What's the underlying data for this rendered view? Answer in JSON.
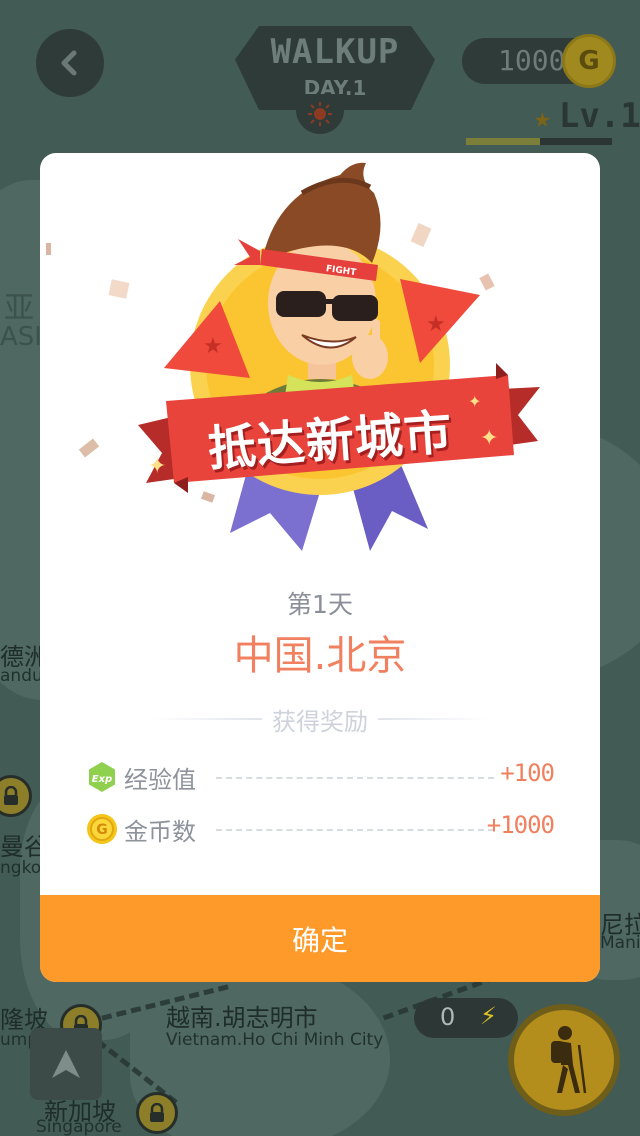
{
  "header": {
    "app_title": "WALKUP",
    "day": "DAY.1",
    "coins": "1000",
    "coin_symbol": "G",
    "level": "Lv.1",
    "level_progress": 0.51
  },
  "map": {
    "labels": [
      {
        "text": "德洲",
        "sub": false
      },
      {
        "text": "andu",
        "sub": true
      },
      {
        "text": "曼谷",
        "sub": false
      },
      {
        "text": "ngkok",
        "sub": true
      },
      {
        "text": "隆坡",
        "sub": false
      },
      {
        "text": "umpur",
        "sub": true
      },
      {
        "text": "越南.胡志明市",
        "sub": false
      },
      {
        "text": "Vietnam.Ho Chi Minh City",
        "sub": true
      },
      {
        "text": "新加坡",
        "sub": false
      },
      {
        "text": "Singapore",
        "sub": true
      },
      {
        "text": "尼拉",
        "sub": false
      },
      {
        "text": "Mani",
        "sub": true
      },
      {
        "text": "亚",
        "sub": false
      },
      {
        "text": "ASI",
        "sub": true
      }
    ],
    "energy": "0"
  },
  "dialog": {
    "banner": "抵达新城市",
    "headband": "FIGHT",
    "day_label": "第1天",
    "city": "中国.北京",
    "reward_title": "获得奖励",
    "rewards": [
      {
        "icon": "exp-icon",
        "icon_text": "Exp",
        "name": "经验值",
        "amount": "+100"
      },
      {
        "icon": "gold-coin-icon",
        "icon_text": "G",
        "name": "金币数",
        "amount": "+1000"
      }
    ],
    "confirm": "确定"
  },
  "colors": {
    "accent_orange": "#fd9a2a",
    "city_color": "#f0805f",
    "banner_red": "#e8443c",
    "ribbon_purple": "#7b6fd0",
    "medal_yellow": "#fbc531"
  }
}
